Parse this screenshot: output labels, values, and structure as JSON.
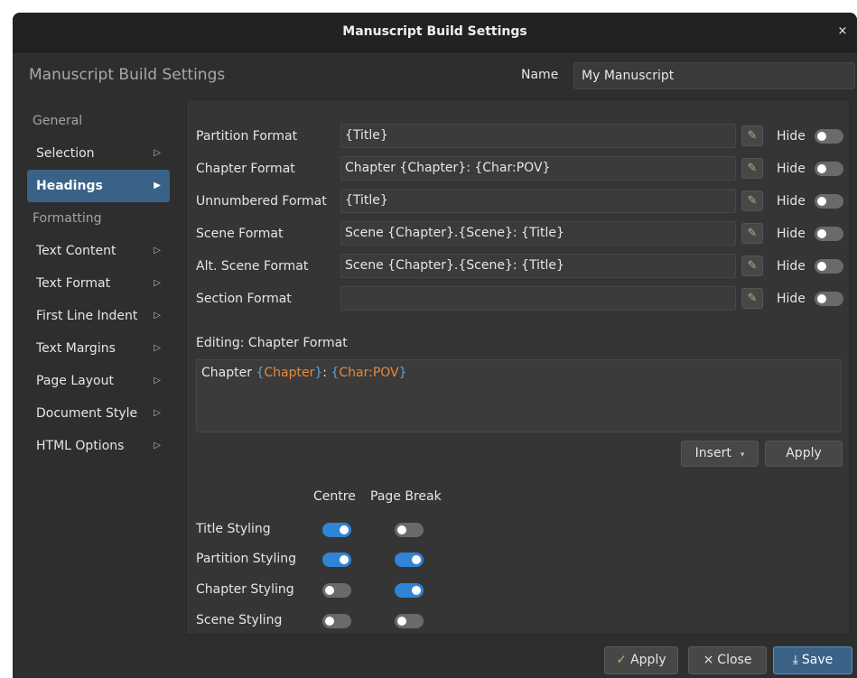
{
  "window": {
    "title": "Manuscript Build Settings",
    "close_icon": "×"
  },
  "header": {
    "title": "Manuscript Build Settings",
    "name_label": "Name",
    "name_value": "My Manuscript"
  },
  "sidebar": {
    "groups": [
      {
        "label": "General",
        "items": [
          {
            "label": "Selection",
            "active": false
          },
          {
            "label": "Headings",
            "active": true
          }
        ]
      },
      {
        "label": "Formatting",
        "items": [
          {
            "label": "Text Content",
            "active": false
          },
          {
            "label": "Text Format",
            "active": false
          },
          {
            "label": "First Line Indent",
            "active": false
          },
          {
            "label": "Text Margins",
            "active": false
          },
          {
            "label": "Page Layout",
            "active": false
          },
          {
            "label": "Document Style",
            "active": false
          },
          {
            "label": "HTML Options",
            "active": false
          }
        ]
      }
    ],
    "chevron": "▷",
    "chevron_active": "▶"
  },
  "formats": {
    "hide_label": "Hide",
    "edit_icon": "pencil-icon",
    "rows": [
      {
        "label": "Partition Format",
        "value": "{Title}",
        "hide": false
      },
      {
        "label": "Chapter Format",
        "value": "Chapter {Chapter}: {Char:POV}",
        "hide": false
      },
      {
        "label": "Unnumbered Format",
        "value": "{Title}",
        "hide": false
      },
      {
        "label": "Scene Format",
        "value": "Scene {Chapter}.{Scene}: {Title}",
        "hide": false
      },
      {
        "label": "Alt. Scene Format",
        "value": "Scene {Chapter}.{Scene}: {Title}",
        "hide": false
      },
      {
        "label": "Section Format",
        "value": "",
        "hide": false
      }
    ]
  },
  "editor": {
    "label": "Editing: Chapter Format",
    "text": {
      "prefix": "Chapter ",
      "open1": "{",
      "kw1": "Chapter",
      "close1": "}",
      "sep": ": ",
      "open2": "{",
      "kw2": "Char:POV",
      "close2": "}"
    },
    "insert_label": "Insert",
    "apply_label": "Apply"
  },
  "styling": {
    "col_centre": "Centre",
    "col_page_break": "Page Break",
    "rows": [
      {
        "label": "Title Styling",
        "centre": true,
        "page_break": false
      },
      {
        "label": "Partition Styling",
        "centre": true,
        "page_break": true
      },
      {
        "label": "Chapter Styling",
        "centre": false,
        "page_break": true
      },
      {
        "label": "Scene Styling",
        "centre": false,
        "page_break": false
      }
    ]
  },
  "footer": {
    "apply": {
      "icon": "✓",
      "label": "Apply"
    },
    "close": {
      "icon": "×",
      "label": "Close"
    },
    "save": {
      "icon": "⤓",
      "label": "Save"
    }
  },
  "colors": {
    "accent": "#2f84d6",
    "selection": "#3a6287",
    "keyword": "#e38b3c",
    "brace": "#5ba0d8"
  }
}
